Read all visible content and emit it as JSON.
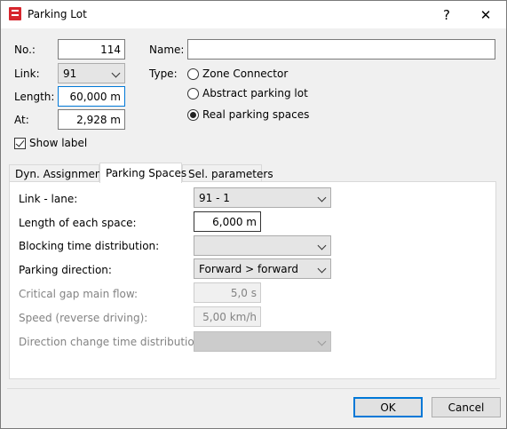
{
  "window": {
    "title": "Parking Lot",
    "help_button": "?",
    "close_button": "✕"
  },
  "fields": {
    "no_label": "No.:",
    "no_value": "114",
    "link_label": "Link:",
    "link_value": "91",
    "length_label": "Length:",
    "length_value": "60,000 m",
    "at_label": "At:",
    "at_value": "2,928 m",
    "name_label": "Name:",
    "name_value": "",
    "type_label": "Type:",
    "show_label": "Show label",
    "show_label_checked": true
  },
  "type_options": [
    {
      "label": "Zone Connector",
      "checked": false
    },
    {
      "label": "Abstract parking lot",
      "checked": false
    },
    {
      "label": "Real parking spaces",
      "checked": true
    }
  ],
  "tabs": [
    {
      "label": "Dyn. Assignment",
      "active": false
    },
    {
      "label": "Parking Spaces",
      "active": true
    },
    {
      "label": "Sel. parameters",
      "active": false
    }
  ],
  "parking_spaces": {
    "link_lane_label": "Link - lane:",
    "link_lane_value": "91 - 1",
    "length_each_label": "Length of each space:",
    "length_each_value": "6,000 m",
    "blocking_label": "Blocking time distribution:",
    "blocking_value": "",
    "direction_label": "Parking direction:",
    "direction_value": "Forward > forward",
    "critical_gap_label": "Critical gap main flow:",
    "critical_gap_value": "5,0 s",
    "speed_label": "Speed (reverse driving):",
    "speed_value": "5,00 km/h",
    "dir_change_label": "Direction change time distribution:",
    "dir_change_value": ""
  },
  "buttons": {
    "ok": "OK",
    "cancel": "Cancel"
  },
  "colors": {
    "accent": "#0078d7",
    "app_icon": "#d7262d",
    "disabled_text": "#838383"
  }
}
